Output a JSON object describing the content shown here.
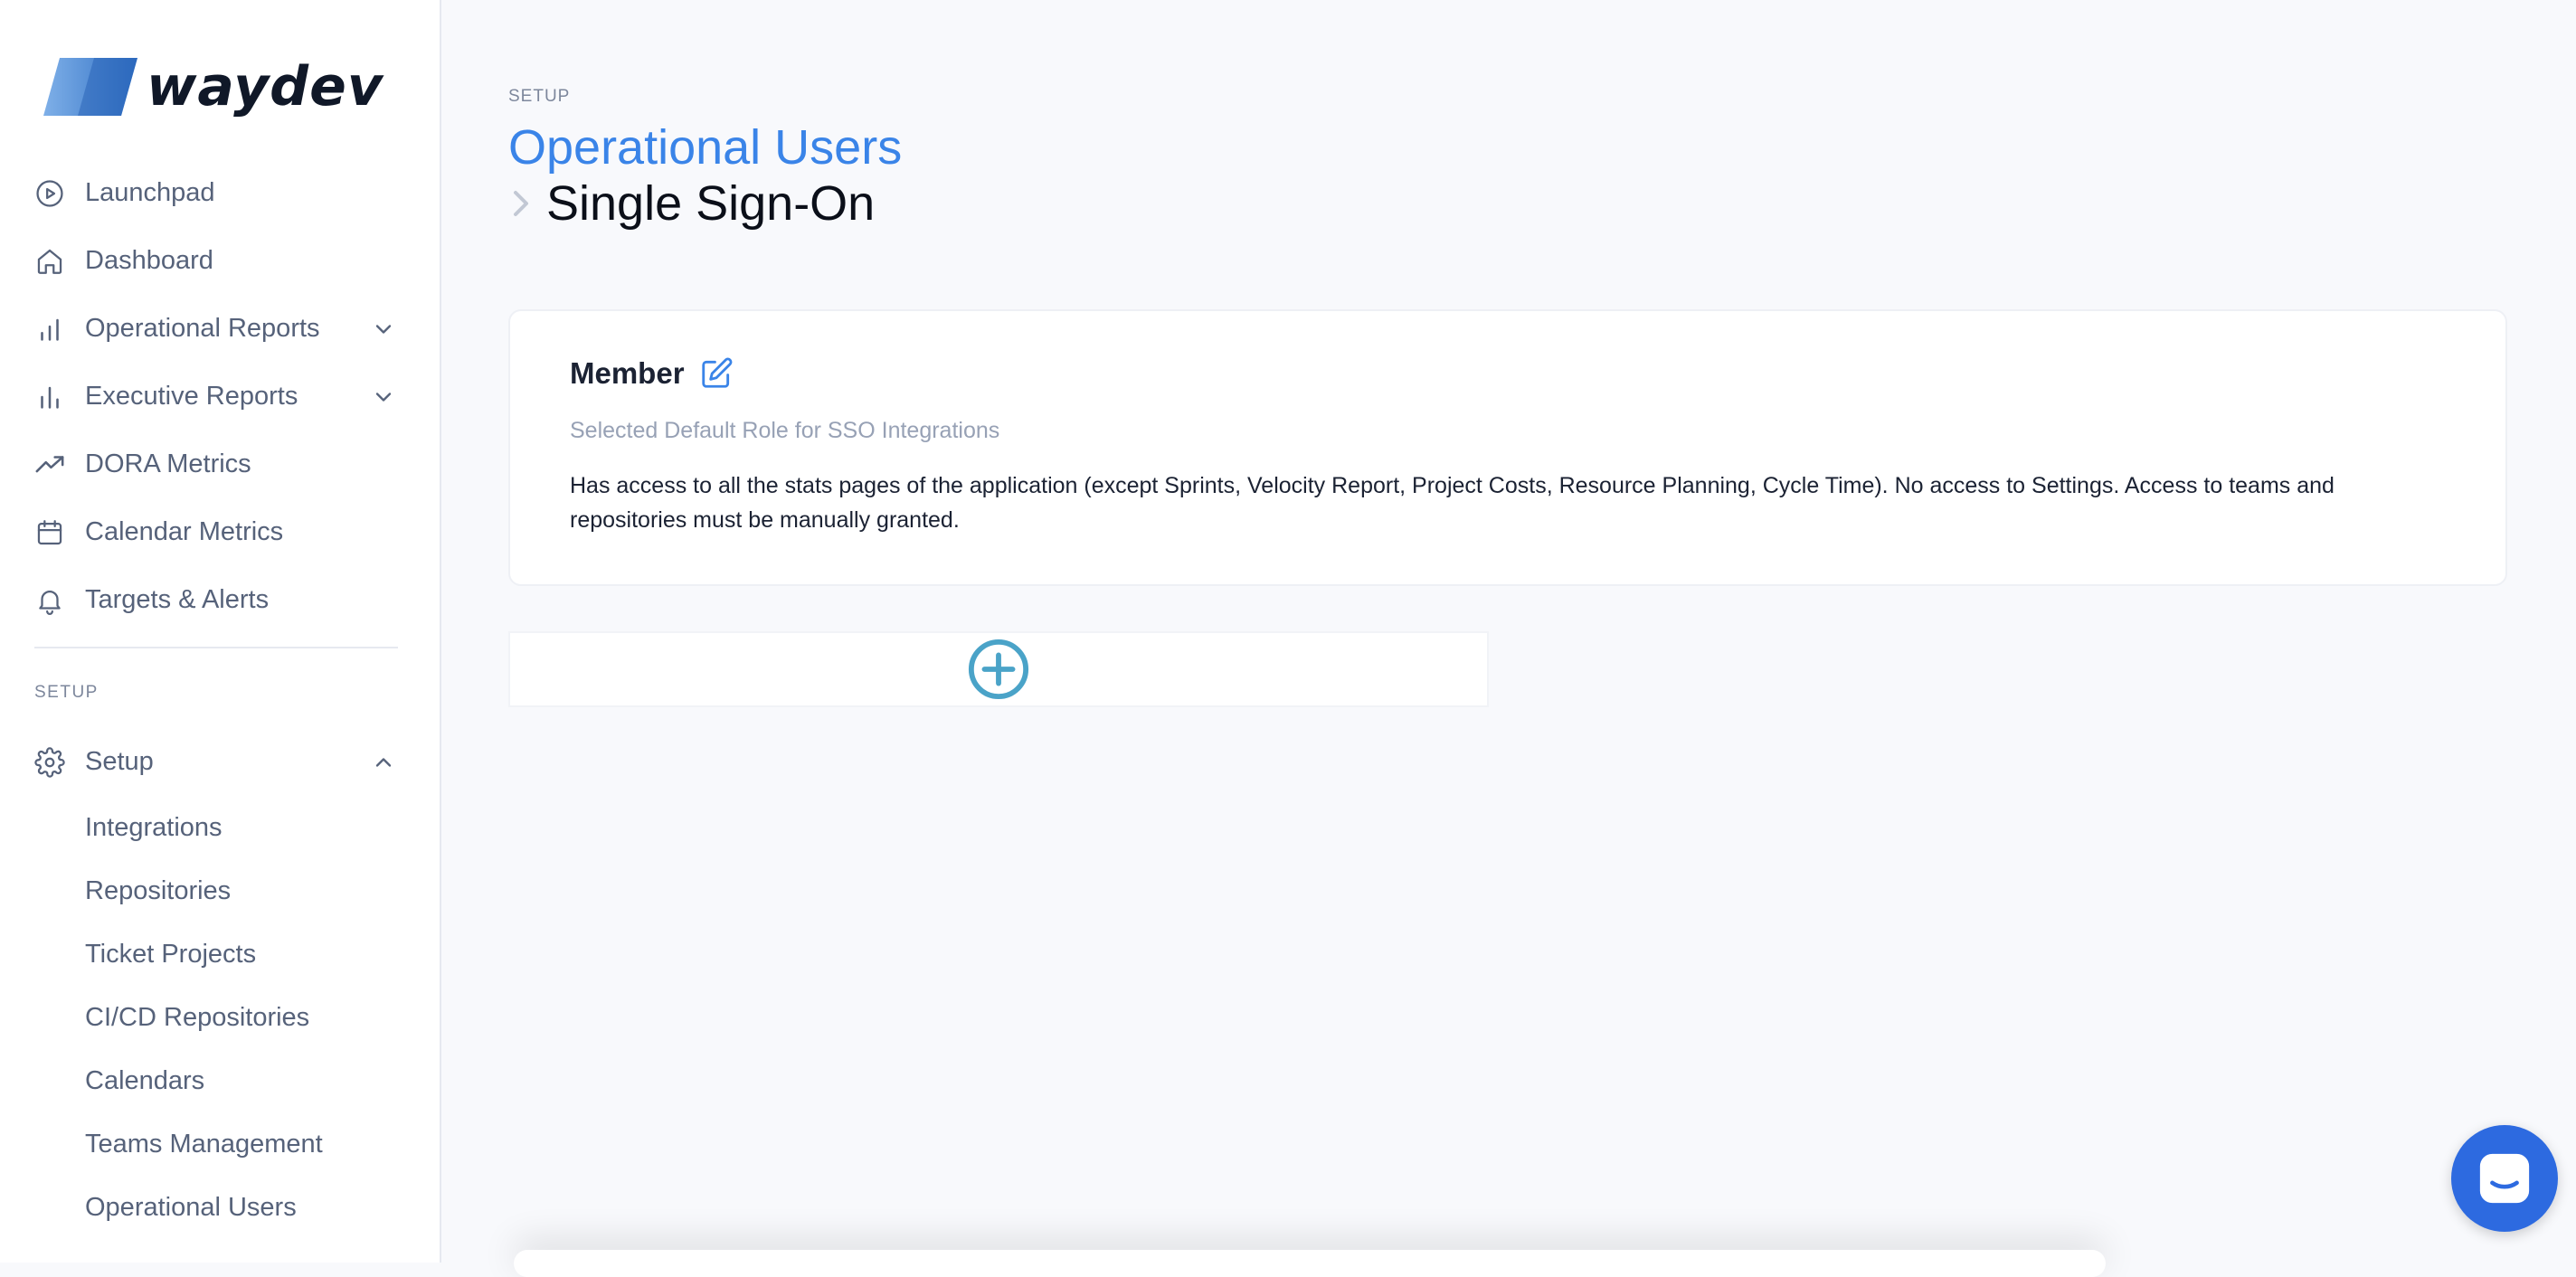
{
  "app": {
    "logo_text": "waydev",
    "colors": {
      "accent": "#3a84e8",
      "launcher": "#2d6ae0",
      "add_icon": "#4aa3c8"
    }
  },
  "sidebar": {
    "items": [
      {
        "label": "Launchpad",
        "icon": "play-circle-icon"
      },
      {
        "label": "Dashboard",
        "icon": "home-icon"
      },
      {
        "label": "Operational Reports",
        "icon": "bar-chart-icon",
        "expandable": true
      },
      {
        "label": "Executive Reports",
        "icon": "bar-chart-icon",
        "expandable": true
      },
      {
        "label": "DORA Metrics",
        "icon": "trending-up-icon"
      },
      {
        "label": "Calendar Metrics",
        "icon": "calendar-icon"
      },
      {
        "label": "Targets & Alerts",
        "icon": "bell-icon"
      }
    ],
    "section_label": "SETUP",
    "setup": {
      "label": "Setup",
      "icon": "gear-icon",
      "sub_items": [
        "Integrations",
        "Repositories",
        "Ticket Projects",
        "CI/CD Repositories",
        "Calendars",
        "Teams Management",
        "Operational Users"
      ]
    }
  },
  "header": {
    "kicker": "SETUP",
    "breadcrumb_parent": "Operational Users",
    "breadcrumb_current": "Single Sign-On"
  },
  "role_card": {
    "name": "Member",
    "subtitle": "Selected Default Role for SSO Integrations",
    "description": "Has access to all the stats pages of the application (except Sprints, Velocity Report, Project Costs, Resource Planning, Cycle Time). No access to Settings. Access to teams and repositories must be manually granted."
  }
}
